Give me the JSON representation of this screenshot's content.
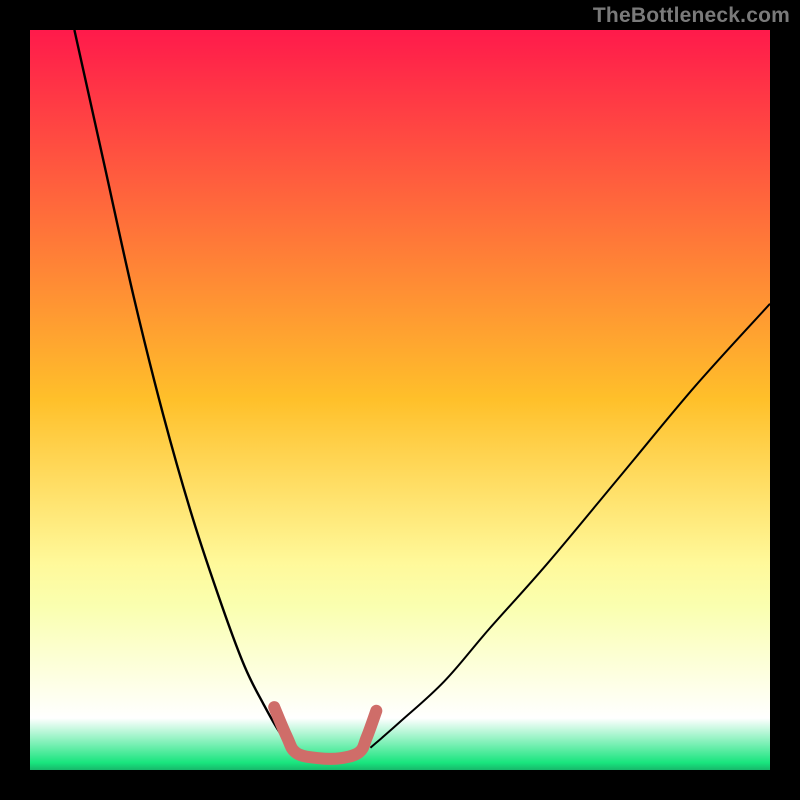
{
  "watermark": {
    "text": "TheBottleneck.com"
  },
  "chart_data": {
    "type": "line",
    "title": "",
    "xlabel": "",
    "ylabel": "",
    "xlim": [
      0,
      100
    ],
    "ylim": [
      0,
      100
    ],
    "grid": false,
    "legend": false,
    "background_gradient": {
      "stops": [
        {
          "offset": 0.0,
          "color": "#ff1a4b"
        },
        {
          "offset": 0.5,
          "color": "#ffc02a"
        },
        {
          "offset": 0.72,
          "color": "#fff99a"
        },
        {
          "offset": 0.78,
          "color": "#faffb0"
        },
        {
          "offset": 0.93,
          "color": "#ffffff"
        },
        {
          "offset": 0.99,
          "color": "#19e57e"
        },
        {
          "offset": 1.0,
          "color": "#17b86a"
        }
      ]
    },
    "series": [
      {
        "name": "left-curve",
        "color": "#000000",
        "width": 2.4,
        "x": [
          6.0,
          10.0,
          14.0,
          18.0,
          22.0,
          26.0,
          29.0,
          31.5,
          33.8,
          36.0
        ],
        "y": [
          100.0,
          82.0,
          64.0,
          48.0,
          34.0,
          22.0,
          14.0,
          9.0,
          5.0,
          2.5
        ]
      },
      {
        "name": "right-curve",
        "color": "#000000",
        "width": 2.0,
        "x": [
          46.0,
          50.0,
          56.0,
          62.0,
          70.0,
          80.0,
          90.0,
          100.0
        ],
        "y": [
          3.0,
          6.5,
          12.0,
          19.0,
          28.0,
          40.0,
          52.0,
          63.0
        ]
      },
      {
        "name": "valley-floor-highlight",
        "color": "#cf6d69",
        "width": 12,
        "cap": "round",
        "x": [
          33.0,
          34.7,
          36.0,
          39.0,
          42.0,
          44.5,
          45.5,
          46.8
        ],
        "y": [
          8.5,
          4.5,
          2.3,
          1.6,
          1.6,
          2.4,
          4.4,
          8.0
        ]
      }
    ]
  }
}
